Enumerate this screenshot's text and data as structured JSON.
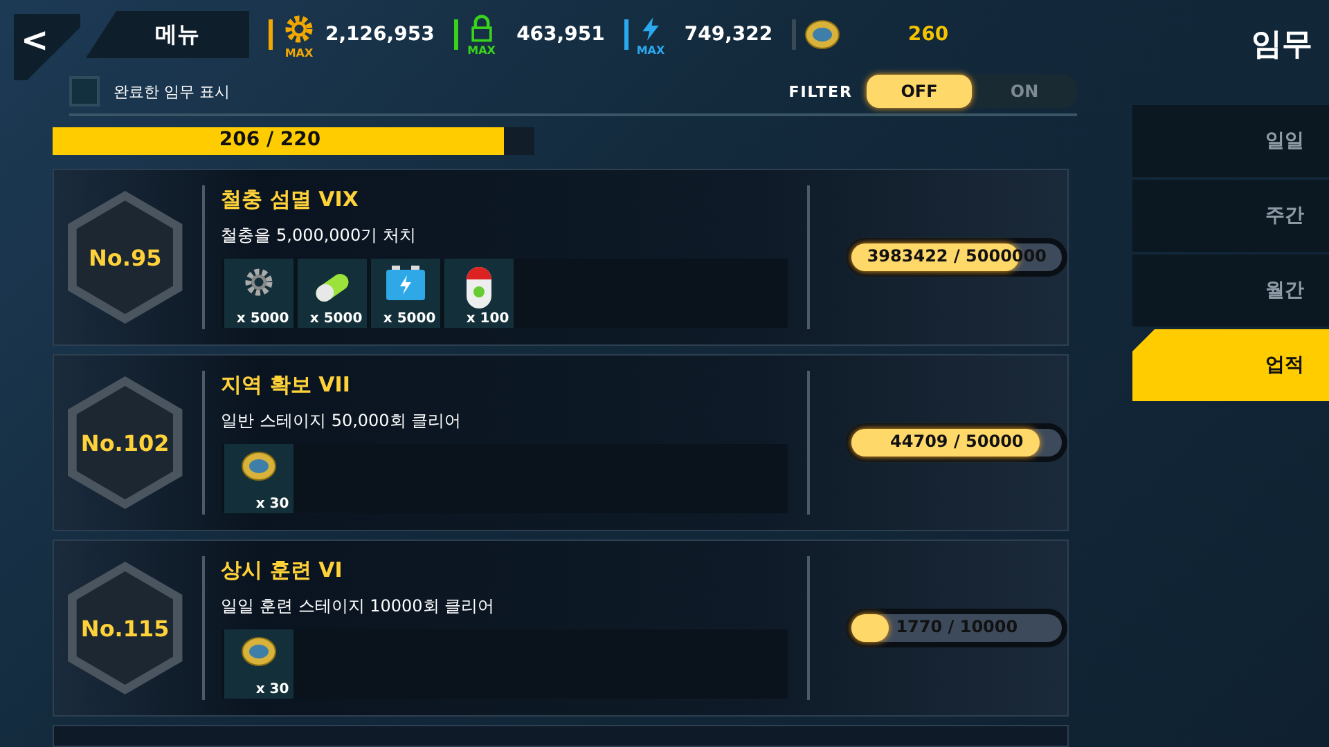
{
  "header": {
    "back": "<",
    "menu": "메뉴",
    "title": "임무"
  },
  "resources": [
    {
      "kind": "gear",
      "badge": "MAX",
      "amount": "2,126,953",
      "color": "#f2a800"
    },
    {
      "kind": "lock",
      "badge": "MAX",
      "amount": "463,951",
      "color": "#39d31c"
    },
    {
      "kind": "bolt",
      "badge": "MAX",
      "amount": "749,322",
      "color": "#2aa8f0"
    },
    {
      "kind": "coin",
      "amount": "260",
      "color": "#f5c400"
    }
  ],
  "show_completed": {
    "label": "완료한 임무 표시",
    "checked": false
  },
  "filter": {
    "label": "FILTER",
    "options": [
      {
        "label": "OFF",
        "selected": true
      },
      {
        "label": "ON",
        "selected": false
      }
    ]
  },
  "total_progress": {
    "text": "206 / 220",
    "level": 0.936
  },
  "missions": [
    {
      "number": "No.95",
      "title": "철충 섬멸 VIX",
      "description": "철충을 5,000,000기 처치",
      "progress": "3983422 / 5000000",
      "level": 0.797,
      "rewards": [
        {
          "kind": "gear",
          "count": "x 5000"
        },
        {
          "kind": "capsule",
          "count": "x 5000"
        },
        {
          "kind": "battery",
          "count": "x 5000"
        },
        {
          "kind": "canister",
          "count": "x 100"
        }
      ]
    },
    {
      "number": "No.102",
      "title": "지역 확보 VII",
      "description": "일반 스테이지 50,000회 클리어",
      "progress": "44709 / 50000",
      "level": 0.894,
      "rewards": [
        {
          "kind": "coin",
          "count": "x 30"
        }
      ]
    },
    {
      "number": "No.115",
      "title": "상시 훈련 VI",
      "description": "일일 훈련 스테이지 10000회 클리어",
      "progress": "1770 / 10000",
      "level": 0.177,
      "rewards": [
        {
          "kind": "coin",
          "count": "x 30"
        }
      ]
    }
  ],
  "tabs": [
    {
      "label": "일일",
      "selected": false
    },
    {
      "label": "주간",
      "selected": false
    },
    {
      "label": "월간",
      "selected": false
    },
    {
      "label": "업적",
      "selected": true
    }
  ]
}
